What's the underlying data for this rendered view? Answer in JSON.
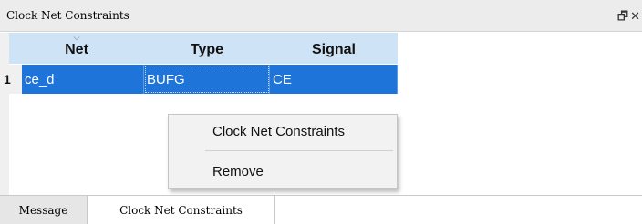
{
  "panel": {
    "title": "Clock Net Constraints",
    "float_icon": "restore-window-icon",
    "close_icon": "close-icon"
  },
  "table": {
    "columns": [
      "Net",
      "Type",
      "Signal"
    ],
    "rows": [
      {
        "num": "1",
        "net": "ce_d",
        "type": "BUFG",
        "signal": "CE"
      }
    ]
  },
  "context_menu": {
    "items": [
      "Clock Net Constraints",
      "Remove"
    ]
  },
  "tabs": [
    "Message",
    "Clock Net Constraints"
  ],
  "active_tab": "Clock Net Constraints",
  "colors": {
    "selection": "#1f74d9",
    "header": "#cfe3f6"
  }
}
